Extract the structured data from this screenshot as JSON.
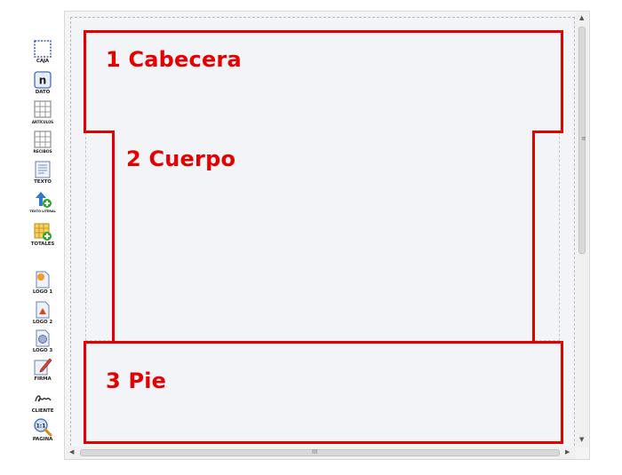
{
  "toolbar": {
    "items": [
      {
        "label": "CAJA",
        "icon": "box-outline-icon"
      },
      {
        "label": "DATO",
        "icon": "data-field-icon"
      },
      {
        "label": "ARTÍCULOS",
        "icon": "grid-table-icon"
      },
      {
        "label": "RECIBOS",
        "icon": "receipts-table-icon"
      },
      {
        "label": "TEXTO",
        "icon": "text-document-icon"
      },
      {
        "label": "TEXTO LITERAL",
        "icon": "literal-text-icon"
      },
      {
        "label": "TOTALES",
        "icon": "totals-table-icon"
      },
      {
        "label": "LOGO 1",
        "icon": "logo-1-icon"
      },
      {
        "label": "LOGO 2",
        "icon": "logo-2-icon"
      },
      {
        "label": "LOGO 3",
        "icon": "logo-3-icon"
      },
      {
        "label": "FIRMA",
        "icon": "signature-pen-icon"
      },
      {
        "label": "CLIENTE",
        "icon": "client-signature-icon"
      },
      {
        "label": "PAGINA",
        "icon": "page-zoom-icon"
      }
    ]
  },
  "sections": {
    "header": {
      "title": "1 Cabecera"
    },
    "body": {
      "title": "2 Cuerpo"
    },
    "footer": {
      "title": "3 Pie"
    }
  },
  "scrollbars": {
    "vertical_grip": "≡",
    "horizontal_grip": "III"
  },
  "colors": {
    "section_border": "#e50000",
    "canvas_bg": "#f3f4f8"
  }
}
